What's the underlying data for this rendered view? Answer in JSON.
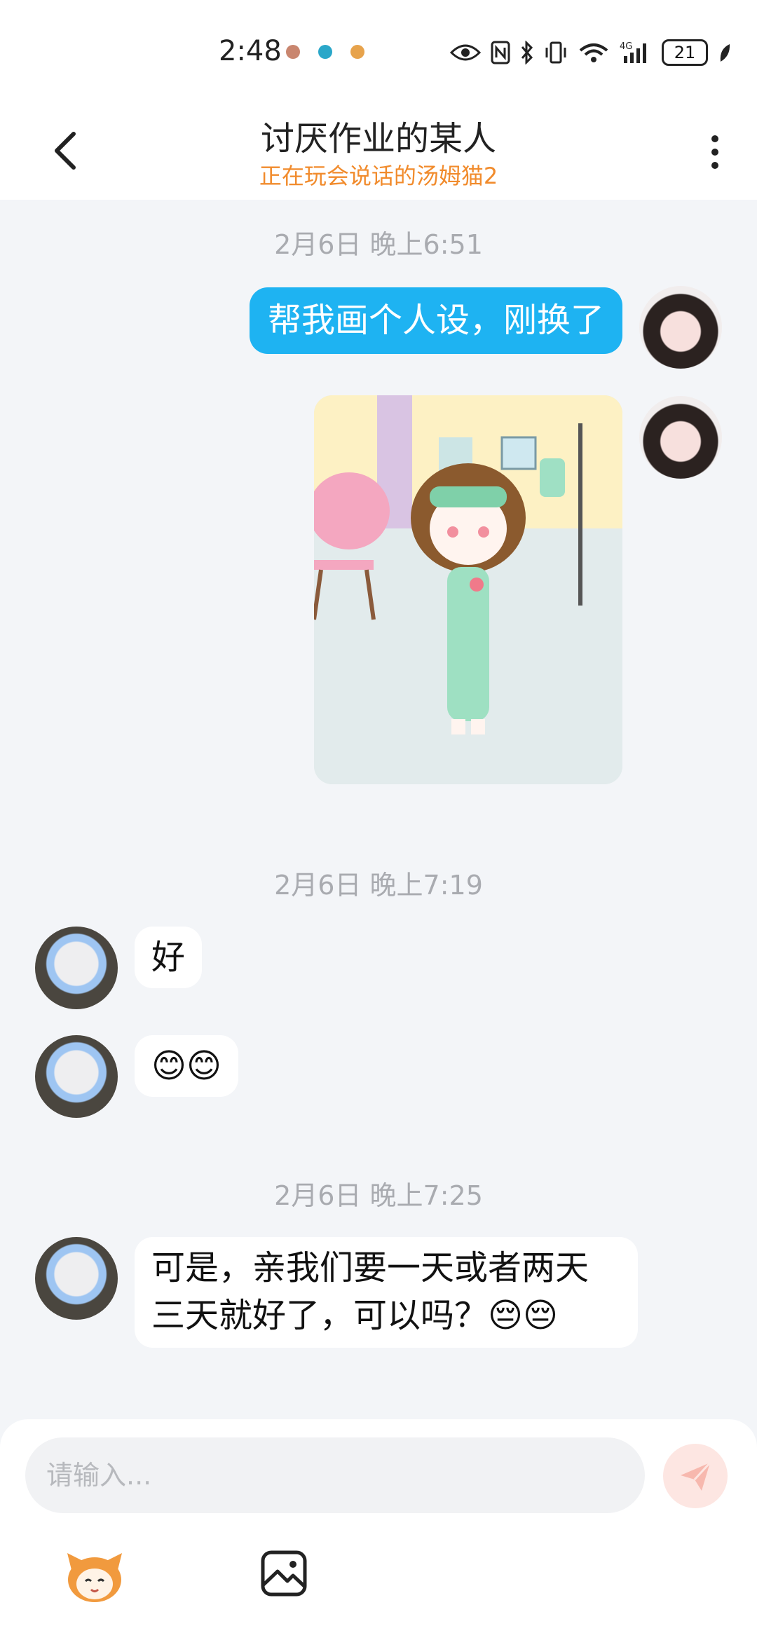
{
  "status_bar": {
    "time": "2:48",
    "battery": "21"
  },
  "header": {
    "title": "讨厌作业的某人",
    "subtitle": "正在玩会说话的汤姆猫2"
  },
  "messages": {
    "ts1": "2月6日 晚上6:51",
    "m1": "帮我画个人设，刚换了",
    "ts2": "2月6日 晚上7:19",
    "m2": "好",
    "m3": "😊😊",
    "ts3": "2月6日 晚上7:25",
    "m4": "可是，亲我们要一天或者两天三天就好了，可以吗？😔😔"
  },
  "input": {
    "placeholder": "请输入..."
  },
  "colors": {
    "accent": "#1eb3f2",
    "subtitle": "#f18b2c",
    "background": "#f3f5f8"
  }
}
